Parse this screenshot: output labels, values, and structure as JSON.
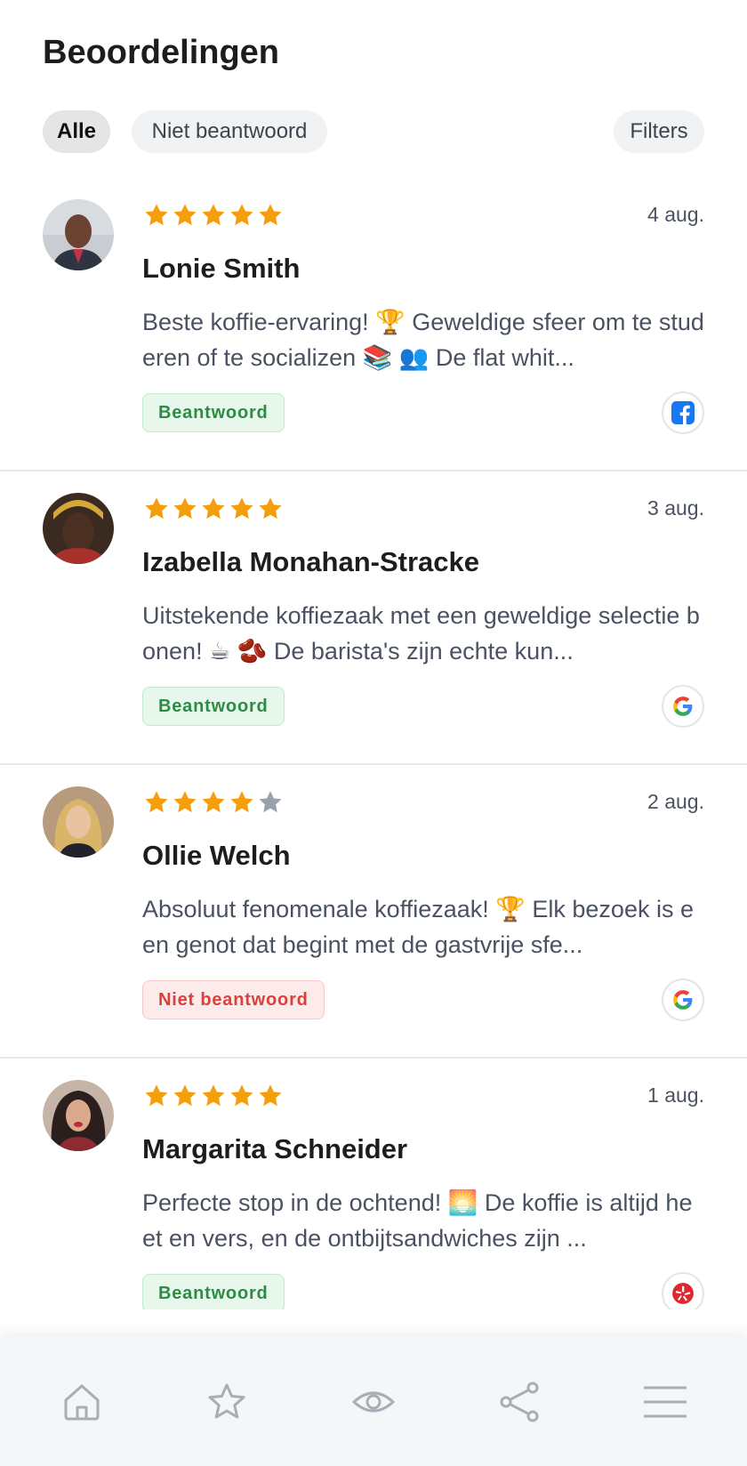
{
  "header": {
    "title": "Beoordelingen",
    "filters": [
      {
        "label": "Alle",
        "active": true
      },
      {
        "label": "Niet beantwoord",
        "active": false
      }
    ],
    "filters_button": "Filters"
  },
  "reviews": [
    {
      "name": "Lonie Smith",
      "rating": 5,
      "date": "4 aug.",
      "text": "Beste koffie-ervaring! 🏆 Geweldige sfeer om te studeren of te socializen 📚 👥 De flat whit...",
      "status": "Beantwoord",
      "answered": true,
      "source": "facebook-icon"
    },
    {
      "name": "Izabella Monahan-Stracke",
      "rating": 5,
      "date": "3 aug.",
      "text": "Uitstekende koffiezaak met een geweldige selectie bonen! ☕ 🫘 De barista's zijn echte kun...",
      "status": "Beantwoord",
      "answered": true,
      "source": "google-icon"
    },
    {
      "name": "Ollie Welch",
      "rating": 4,
      "date": "2 aug.",
      "text": "Absoluut fenomenale koffiezaak! 🏆 Elk bezoek is een genot dat begint met de gastvrije sfe...",
      "status": "Niet beantwoord",
      "answered": false,
      "source": "google-icon"
    },
    {
      "name": "Margarita Schneider",
      "rating": 5,
      "date": "1 aug.",
      "text": "Perfecte stop in de ochtend! 🌅 De koffie is altijd heet en vers, en de ontbijtsandwiches zijn ...",
      "status": "Beantwoord",
      "answered": true,
      "source": "yelp-icon"
    }
  ],
  "colors": {
    "star_filled": "#f59e0b",
    "star_empty": "#9aa1ad",
    "answered_text": "#2e8b45",
    "unanswered_text": "#d9413a"
  },
  "nav": [
    "home-icon",
    "star-icon",
    "eye-icon",
    "share-icon",
    "menu-icon"
  ]
}
